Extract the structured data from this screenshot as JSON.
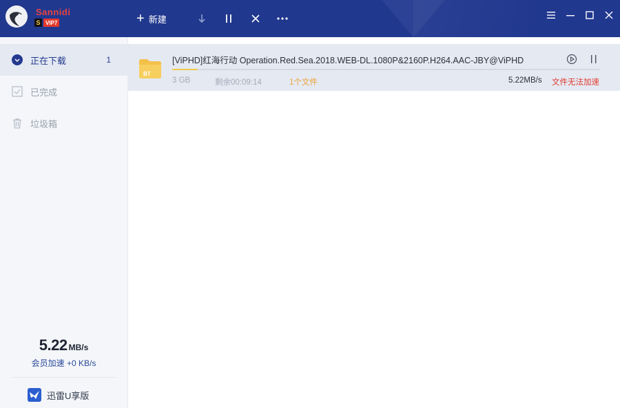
{
  "header": {
    "username": "Sannidi",
    "badge_s": "S",
    "badge_vip": "VIP7",
    "new_label": "新建",
    "icons": [
      "plus-icon",
      "download-icon",
      "pause-icon",
      "close-icon",
      "more-icon"
    ],
    "window_icons": [
      "menu-icon",
      "minimize-icon",
      "maximize-icon",
      "close-icon"
    ]
  },
  "sidebar": {
    "items": [
      {
        "label": "正在下载",
        "count": "1",
        "icon": "chevron-down-circle-icon"
      },
      {
        "label": "已完成",
        "icon": "checkbox-icon"
      },
      {
        "label": "垃圾箱",
        "icon": "trash-icon"
      }
    ],
    "speed_value": "5.22",
    "speed_unit": "MB/s",
    "speed_sub": "会员加速 +0 KB/s",
    "udisk_label": "迅雷U享版"
  },
  "downloads": [
    {
      "name": "[ViPHD]红海行动 Operation.Red.Sea.2018.WEB-DL.1080P&2160P.H264.AAC-JBY@ViPHD",
      "size": "3 GB",
      "remaining": "剩余00:09:14",
      "files": "1个文件",
      "rate": "5.22MB/s",
      "warning": "文件无法加速",
      "progress": 0.06,
      "folder_tag": "BT"
    }
  ],
  "colors": {
    "header_bg": "#21388f",
    "accent": "#243a8f",
    "progress": "#f2c94c",
    "warning": "#e23a2e",
    "files_orange": "#f0a33a"
  }
}
